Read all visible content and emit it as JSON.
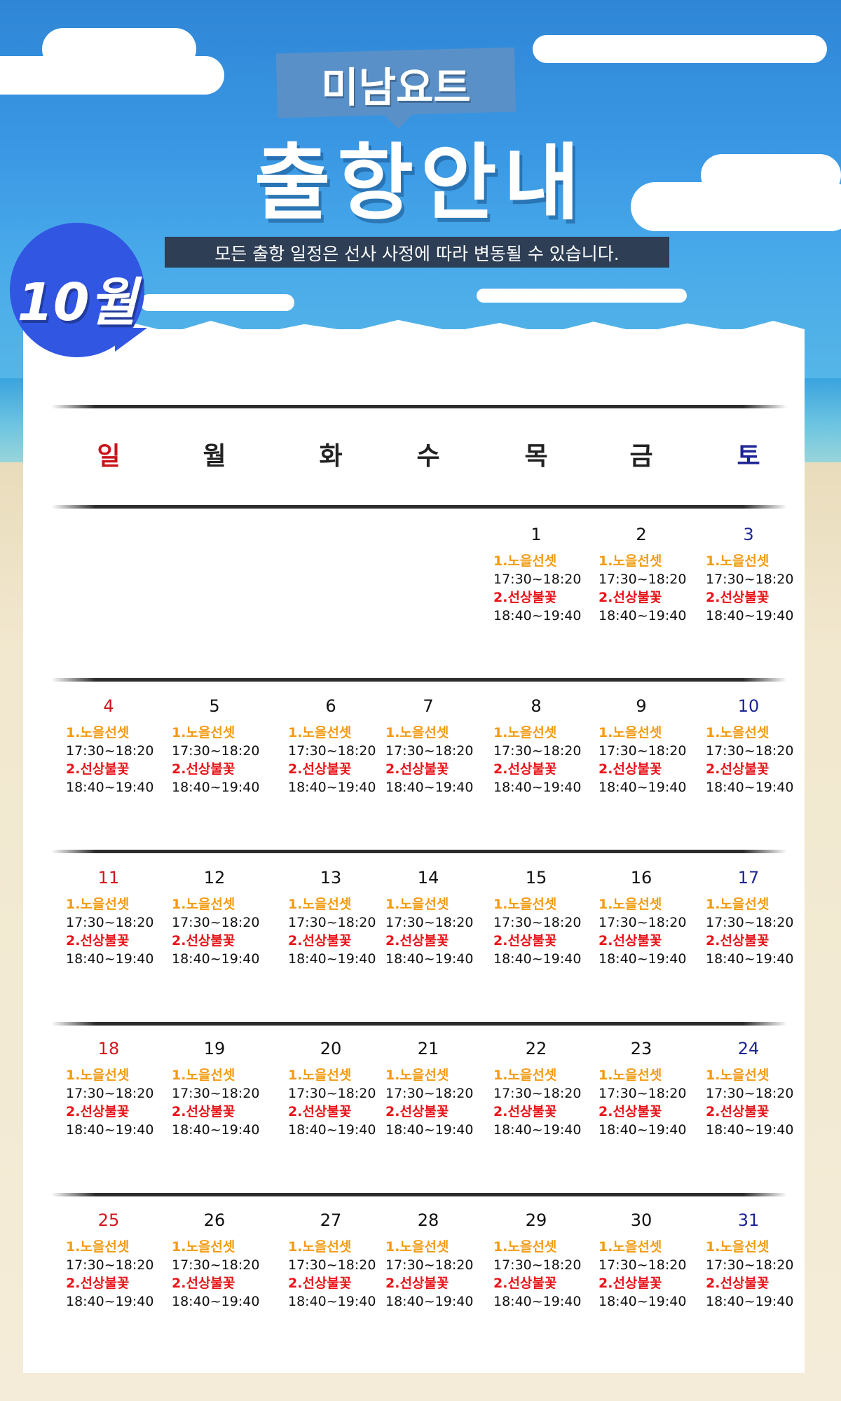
{
  "header": {
    "brand": "미남요트",
    "title": "출항안내",
    "notice": "모든 출항 일정은 선사 사정에 따라 변동될 수 있습니다.",
    "month": "10월"
  },
  "calendar": {
    "weekdays": [
      {
        "label": "일",
        "type": "sun"
      },
      {
        "label": "월",
        "type": "wk"
      },
      {
        "label": "화",
        "type": "wk"
      },
      {
        "label": "수",
        "type": "wk"
      },
      {
        "label": "목",
        "type": "wk"
      },
      {
        "label": "금",
        "type": "wk"
      },
      {
        "label": "토",
        "type": "sat"
      }
    ],
    "first_weekday_index": 4,
    "days_in_month": 31,
    "default_schedule": {
      "event1": "1.노을선셋",
      "time1": "17:30~18:20",
      "event2": "2.선상불꽃",
      "time2": "18:40~19:40"
    }
  },
  "colors": {
    "sunday": "#d4141c",
    "saturday": "#1e2596",
    "event1": "#f39b12",
    "event2": "#e8141a",
    "badge": "#3156e2"
  }
}
